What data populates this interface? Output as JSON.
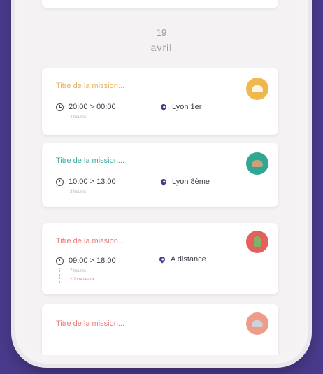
{
  "date": {
    "day": "19",
    "month": "avril"
  },
  "missions": [
    {
      "title": "Titre de la mission...",
      "time": "20:00 > 00:00",
      "duration": "4 heures",
      "location": "Lyon 1er",
      "title_color": "#e9b25a",
      "avatar_color": "#efb84e"
    },
    {
      "title": "Titre de la mission...",
      "time": "10:00 > 13:00",
      "duration": "3 heures",
      "location": "Lyon 8ème",
      "title_color": "#3aaaa0",
      "avatar_color": "#2fa794"
    },
    {
      "title": "Titre de la mission...",
      "time": "09:00 > 18:00",
      "duration": "7 heures",
      "extra": "+ 2 créneaux",
      "location": "A distance",
      "title_color": "#ea7a78",
      "avatar_color": "#e65f5b"
    },
    {
      "title": "Titre de la mission...",
      "title_color": "#ea7a78",
      "avatar_color": "#ef9b8a"
    }
  ]
}
